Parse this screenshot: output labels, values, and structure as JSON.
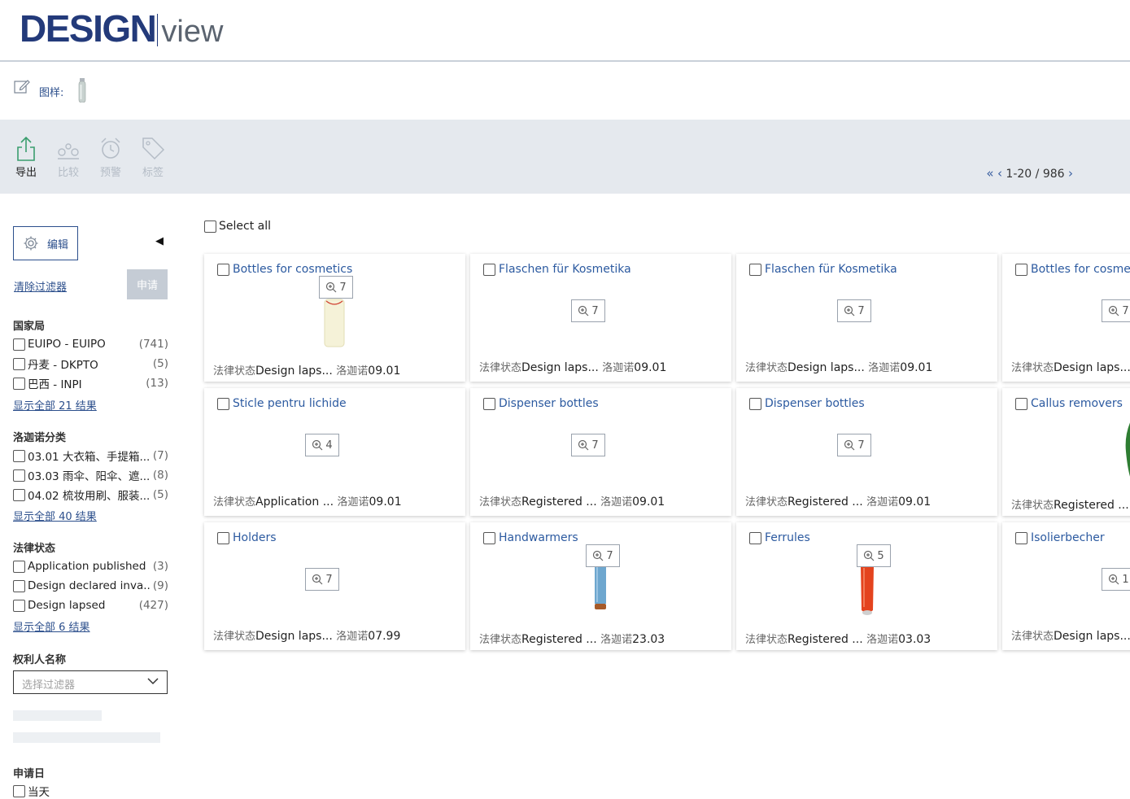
{
  "brand": {
    "main": "DESIGN",
    "sub": "view"
  },
  "search": {
    "design_label": "图样:"
  },
  "toolbar": {
    "export": "导出",
    "compare": "比较",
    "alert": "预警",
    "tag": "标签",
    "pager": "1-20 / 986"
  },
  "sidebar": {
    "edit": "编辑",
    "clear_filters": "清除过滤器",
    "apply": "申请",
    "offices": {
      "title": "国家局",
      "items": [
        {
          "label": "EUIPO - EUIPO",
          "count": "(741)"
        },
        {
          "label": "丹麦 - DKPTO",
          "count": "(5)"
        },
        {
          "label": "巴西 - INPI",
          "count": "(13)"
        }
      ],
      "more": "显示全部 21 结果"
    },
    "locarno": {
      "title": "洛迦诺分类",
      "items": [
        {
          "label": "03.01 大衣箱、手提箱...",
          "count": "(7)"
        },
        {
          "label": "03.03 雨伞、阳伞、遮...",
          "count": "(8)"
        },
        {
          "label": "04.02 梳妆用刷、服装...",
          "count": "(5)"
        }
      ],
      "more": "显示全部 40 结果"
    },
    "status": {
      "title": "法律状态",
      "items": [
        {
          "label": "Application published",
          "count": "(3)"
        },
        {
          "label": "Design declared inva...",
          "count": "(9)"
        },
        {
          "label": "Design lapsed",
          "count": "(427)"
        }
      ],
      "more": "显示全部 6 结果"
    },
    "owner": {
      "title": "权利人名称",
      "placeholder": "选择过滤器"
    },
    "filing": {
      "title": "申请日",
      "first_option": "当天"
    }
  },
  "results": {
    "select_all": "Select all",
    "status_key": "法律状态",
    "locarno_key": "洛迦诺",
    "cards": [
      {
        "title": "Bottles for cosmetics",
        "images": "7",
        "status": "Design laps...",
        "locarno": "09.01"
      },
      {
        "title": "Flaschen für Kosmetika",
        "images": "7",
        "status": "Design laps...",
        "locarno": "09.01"
      },
      {
        "title": "Flaschen für Kosmetika",
        "images": "7",
        "status": "Design laps...",
        "locarno": "09.01"
      },
      {
        "title": "Bottles for cosmet",
        "images": "7",
        "status": "Design laps...",
        "locarno": ""
      },
      {
        "title": "Sticle pentru lichide",
        "images": "4",
        "status": "Application ...",
        "locarno": "09.01"
      },
      {
        "title": "Dispenser bottles",
        "images": "7",
        "status": "Registered ...",
        "locarno": "09.01"
      },
      {
        "title": "Dispenser bottles",
        "images": "7",
        "status": "Registered ...",
        "locarno": "09.01"
      },
      {
        "title": "Callus removers",
        "images": "",
        "status": "Registered ...",
        "locarno": ""
      },
      {
        "title": "Holders",
        "images": "7",
        "status": "Design laps...",
        "locarno": "07.99"
      },
      {
        "title": "Handwarmers",
        "images": "7",
        "status": "Registered ...",
        "locarno": "23.03"
      },
      {
        "title": "Ferrules",
        "images": "5",
        "status": "Registered ...",
        "locarno": "03.03"
      },
      {
        "title": "Isolierbecher",
        "images": "1",
        "status": "Design laps...",
        "locarno": ""
      }
    ]
  }
}
